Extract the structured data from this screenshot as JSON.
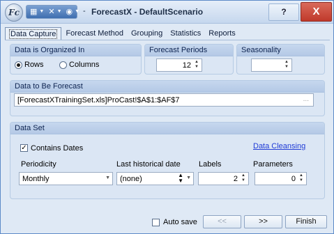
{
  "window": {
    "logo_text": "Fc",
    "title_separator": "-",
    "title": "ForecastX - DefaultScenario",
    "help_label": "?",
    "close_label": "X"
  },
  "quick_access": {
    "icons": [
      "table-icon",
      "tools-icon",
      "help-circle-icon"
    ]
  },
  "tabs": [
    {
      "label": "Data Capture",
      "active": true
    },
    {
      "label": "Forecast Method",
      "active": false
    },
    {
      "label": "Grouping",
      "active": false
    },
    {
      "label": "Statistics",
      "active": false
    },
    {
      "label": "Reports",
      "active": false
    }
  ],
  "organized": {
    "heading": "Data is Organized In",
    "rows_label": "Rows",
    "columns_label": "Columns",
    "selected": "Rows"
  },
  "forecast_periods": {
    "heading": "Forecast Periods",
    "value": "12"
  },
  "seasonality": {
    "heading": "Seasonality",
    "value": ""
  },
  "data_forecast": {
    "heading": "Data to Be Forecast",
    "value": "[ForecastXTrainingSet.xls]ProCast!$A$1:$AF$7",
    "ellipsis": "..."
  },
  "data_set": {
    "heading": "Data Set",
    "contains_dates_label": "Contains Dates",
    "contains_dates_checked": true,
    "data_cleansing_link": "Data Cleansing",
    "periodicity_label": "Periodicity",
    "periodicity_value": "Monthly",
    "last_date_label": "Last historical date",
    "last_date_value": "(none)",
    "labels_label": "Labels",
    "labels_value": "2",
    "parameters_label": "Parameters",
    "parameters_value": "0"
  },
  "footer": {
    "auto_save_label": "Auto save",
    "auto_save_checked": false,
    "back_label": "<<",
    "next_label": ">>",
    "finish_label": "Finish"
  }
}
